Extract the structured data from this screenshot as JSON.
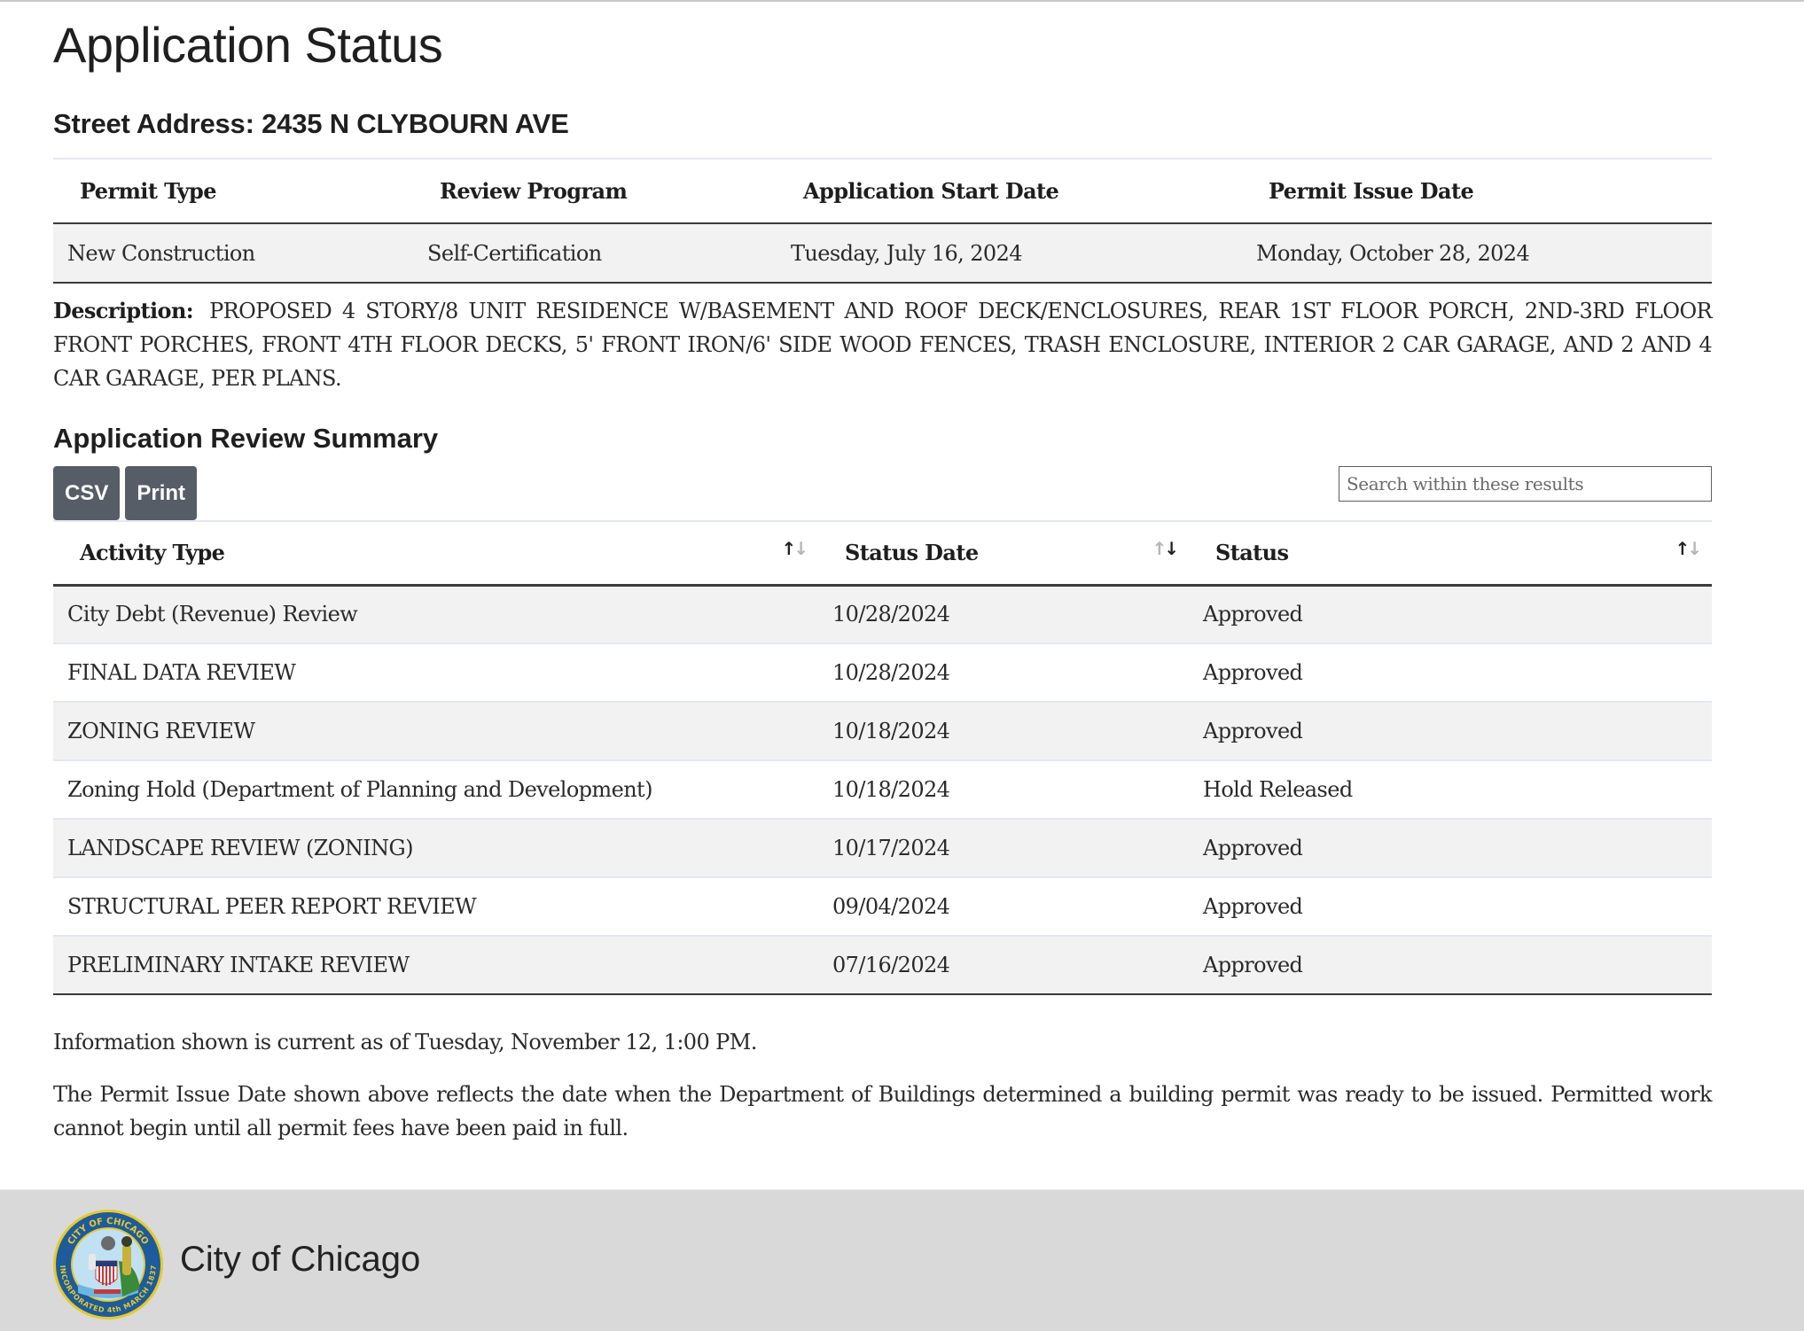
{
  "page": {
    "title": "Application Status",
    "address_label": "Street Address:",
    "address_value": "2435 N CLYBOURN AVE"
  },
  "permit": {
    "headers": [
      "Permit Type",
      "Review Program",
      "Application Start Date",
      "Permit Issue Date"
    ],
    "values": [
      "New Construction",
      "Self-Certification",
      "Tuesday, July 16, 2024",
      "Monday, October 28, 2024"
    ],
    "description_label": "Description:",
    "description": "PROPOSED 4 STORY/8 UNIT RESIDENCE W/BASEMENT AND ROOF DECK/ENCLOSURES, REAR 1ST FLOOR PORCH, 2ND-3RD FLOOR FRONT PORCHES, FRONT 4TH FLOOR DECKS, 5' FRONT IRON/6' SIDE WOOD FENCES, TRASH ENCLOSURE, INTERIOR 2 CAR GARAGE, AND 2 AND 4 CAR GARAGE, PER PLANS."
  },
  "review": {
    "title": "Application Review Summary",
    "buttons": {
      "csv": "CSV",
      "print": "Print"
    },
    "search_placeholder": "Search within these results",
    "headers": [
      {
        "label": "Activity Type",
        "sort": "asc"
      },
      {
        "label": "Status Date",
        "sort": "desc"
      },
      {
        "label": "Status",
        "sort": "asc"
      }
    ],
    "sort_up_glyph": "↑",
    "sort_down_glyph": "↓",
    "rows": [
      {
        "activity": "City Debt (Revenue) Review",
        "date": "10/28/2024",
        "status": "Approved"
      },
      {
        "activity": "FINAL DATA REVIEW",
        "date": "10/28/2024",
        "status": "Approved"
      },
      {
        "activity": "ZONING REVIEW",
        "date": "10/18/2024",
        "status": "Approved"
      },
      {
        "activity": "Zoning Hold (Department of Planning and Development)",
        "date": "10/18/2024",
        "status": "Hold Released"
      },
      {
        "activity": "LANDSCAPE REVIEW (ZONING)",
        "date": "10/17/2024",
        "status": "Approved"
      },
      {
        "activity": "STRUCTURAL PEER REPORT REVIEW",
        "date": "09/04/2024",
        "status": "Approved"
      },
      {
        "activity": "PRELIMINARY INTAKE REVIEW",
        "date": "07/16/2024",
        "status": "Approved"
      }
    ]
  },
  "notes": {
    "info": "Information shown is current as of Tuesday, November 12, 1:00 PM.",
    "disclaimer": "The Permit Issue Date shown above reflects the date when the Department of Buildings determined a building permit was ready to be issued. Permitted work cannot begin until all permit fees have been paid in full."
  },
  "footer": {
    "name": "City of Chicago",
    "seal_top_text": "CITY OF CHICAGO",
    "seal_bottom_text": "INCORPORATED 4th MARCH 1837"
  },
  "colors": {
    "button_bg": "#575d66",
    "footer_bg": "#d9d9d9",
    "stripe_bg": "#f2f2f2",
    "seal_ring": "#1e5b9c",
    "seal_gold": "#e6c92a"
  }
}
